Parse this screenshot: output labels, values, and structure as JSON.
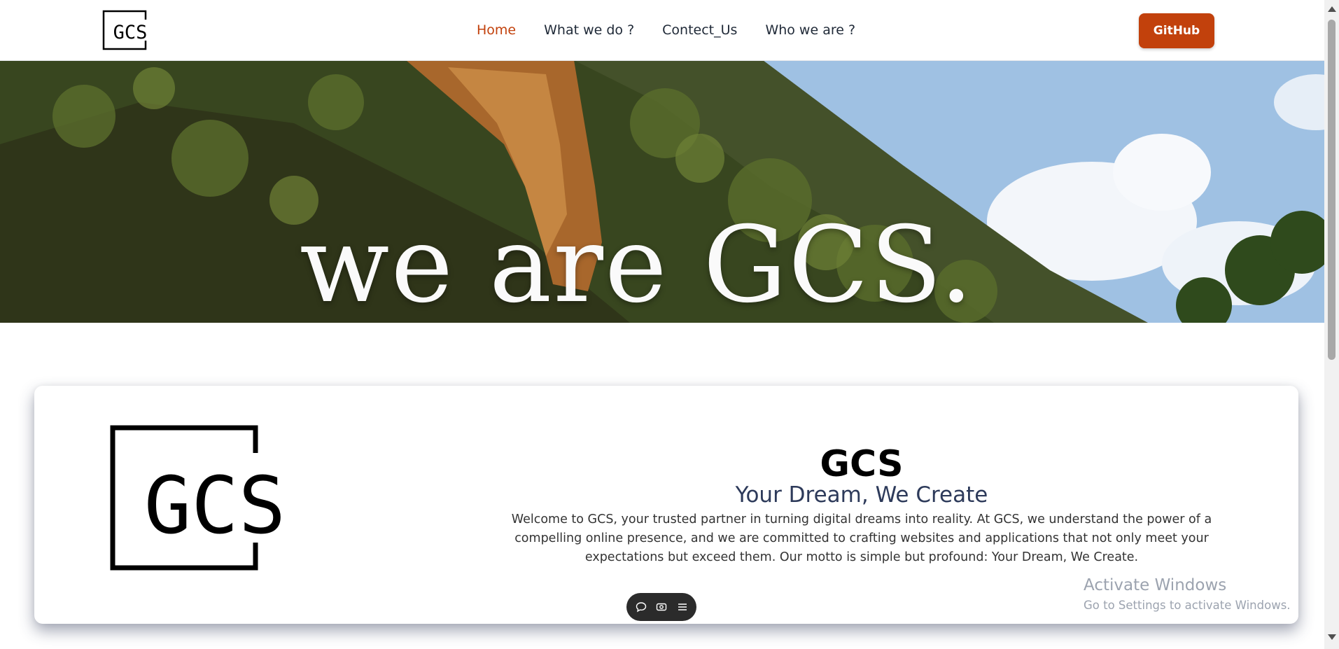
{
  "brand": {
    "logo_text": "GCS"
  },
  "nav": {
    "items": [
      {
        "label": "Home",
        "active": true
      },
      {
        "label": "What we do ?",
        "active": false
      },
      {
        "label": "Contect_Us",
        "active": false
      },
      {
        "label": "Who we are ?",
        "active": false
      }
    ]
  },
  "header": {
    "github_label": "GitHub"
  },
  "hero": {
    "headline": "we are GCS."
  },
  "about": {
    "title": "GCS",
    "subtitle": "Your Dream, We Create",
    "description": "Welcome to GCS, your trusted partner in turning digital dreams into reality. At GCS, we understand the power of a compelling online presence, and we are committed to crafting websites and applications that not only meet your expectations but exceed them. Our motto is simple but profound: Your Dream, We Create."
  },
  "toolbar": {
    "icons": [
      "chat-icon",
      "camera-icon",
      "menu-icon"
    ]
  },
  "watermark": {
    "title": "Activate Windows",
    "subtitle": "Go to Settings to activate Windows."
  },
  "colors": {
    "accent": "#c2410c",
    "text_dark": "#1f2937",
    "subtitle": "#2d3a5a"
  }
}
